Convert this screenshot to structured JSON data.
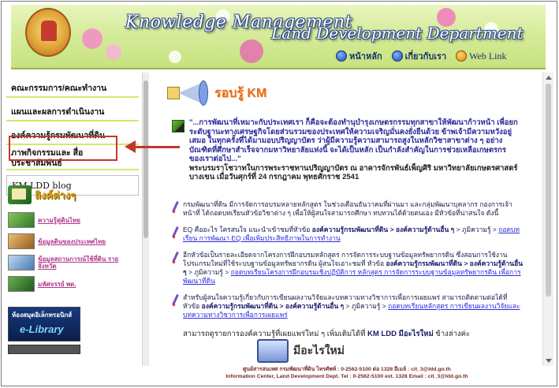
{
  "header": {
    "title_km": "Knowledge Management",
    "title_ldd": "Land Development Department",
    "nav": [
      {
        "label": "หน้าหลัก",
        "icon": "home-icon"
      },
      {
        "label": "เกี่ยวกับเรา",
        "icon": "info-icon"
      },
      {
        "label": "Web Link",
        "icon": "globe-icon"
      }
    ]
  },
  "sidebar": {
    "menu": [
      {
        "label": "คณะกรรมการ/คณะทำงาน"
      },
      {
        "label": "แผนและผลการดำเนินงาน"
      },
      {
        "label": "องค์ความรู้กรมพัฒนาที่ดิน"
      },
      {
        "label": "ภาพกิจกรรมและ สื่อประชาสัมพันธ์"
      }
    ],
    "km_blog": "KM LDD blog",
    "links_header": "ลิงค์ต่างๆ",
    "links": [
      {
        "label": "ความรู้คู่ดินไทย"
      },
      {
        "label": "ข้อมูลดินของประเทศไทย"
      },
      {
        "label": "ข้อมูลสถานการณ์ใช้ที่ดิน รายจังหวัด"
      },
      {
        "label": "มหัศจรรย์ พด."
      }
    ],
    "elibrary_top": "ห้องสมุดอิเล็กทรอนิกส์",
    "elibrary_main": "e-Library"
  },
  "main": {
    "news_title": "รอบรู้ KM",
    "quote": "\"...การพัฒนาที่เหมาะกับประเทศเรา ก็คือจะต้องทำนุบำรุงเกษตรกรรมทุกสาขาให้พัฒนาก้าวหน้า เพื่อยกระดับฐานะทางเศรษฐกิจโดยส่วนรวมของประเทศให้ความเจริญมั่นคงยั่งยืนด้วย ข้าพเจ้ามีความหวังอยู่เสมอ ในทุกครั้งที่ได้มามอบปริญญาบัตร ว่าผู้มีความรู้ความสามารถสูงในหลักวิชาสาขาต่าง ๆ อย่างบัณฑิตที่ศึกษาสำเร็จจากมหาวิทยาลัยแห่งนี้ จะได้เป็นหลัก เป็นกำลังสำคัญในการช่วยเหลือเกษตรกรของเราต่อไป...\"",
    "quote_ref": "พระบรมราโชวาทในการพระราชทานปริญญาบัตร ณ อาคารจักรพันธ์เพ็ญศิริ มหาวิทยาลัยเกษตรศาสตร์ บางเขน เมื่อวันศุกร์ที่ 24 กรกฎาคม พุทธศักราช 2541",
    "items": [
      {
        "text": "กรมพัฒนาที่ดิน มีการจัดการอบรมหลายหลักสูตร ในช่วงเดือนธันวาคมที่ผ่านมา และกลุ่มพัฒนาบุคลากร กองการเจ้าหน้าที่ ได้ถอดบทเรียนหัวข้อวิชาต่าง ๆ เพื่อให้ผู้สนใจสามารถศึกษา ทบทวนได้ด้วยตนเอง มีหัวข้อที่น่าสนใจ ดังนี้"
      },
      {
        "text": "EQ คืออะไร ใครสนใจ แนะนำเข้าชมที่หัวข้อ",
        "bold": "องค์ความรู้กรมพัฒนาที่ดิน > องค์ความรู้ด้านอื่น ๆ",
        "text2": " > ภูมิความรู้ > ",
        "link": "ถอดบทเรียน การพัฒนา EQ เพื่อเพิ่มประสิทธิภาพในการทำงาน"
      },
      {
        "text": "อีกหัวข้อเป็นรายละเอียดจากโครงการฝึกอบรมหลักสูตร การจัดการระบบฐานข้อมูลทรัพยากรดิน ซึ่งสอนการใช้งานโปรแกรมใหม่ที่ใช้ระบบฐานข้อมูลทรัพยากรดิน ผู้สนใจเอาะชมที่ หัวข้อ",
        "bold": "องค์ความรู้กรมพัฒนาที่ดิน > องค์ความรู้ด้านอื่น ๆ",
        "text2": " > ภูมิความรู้ > ",
        "link": "ถอดบทเรียนโครงการฝึกอบรมเชิงปฏิบัติการ หลักสูตร การจัดการระบบฐานข้อมูลทรัพยากรดิน เพื่อการพัฒนาที่ดิน"
      },
      {
        "text": "สำหรับผู้สนใจความรู้เกี่ยวกับการเขียนผลงานวิจัยและบทความทางวิชาการเพื่อการเผยแพร่ สามารถติดตามต่อได้ที่หัวข้อ",
        "bold": "องค์ความรู้กรมพัฒนาที่ดิน > องค์ความรู้ด้านอื่น ๆ",
        "text2": " > ภูมิความรู้ > ",
        "link": "ถอดบทเรียนหลักสูตร การเขียนผลงานวิจัยและบทความทางวิชาการเพื่อการเผยแพร่"
      }
    ],
    "more_prefix": "สามารถดูรายการองค์ความรู้ที่เผยแพร่ใหม่ ๆ เพิ่มเติมได้ที่",
    "more_bold": "KM LDD มีอะไรใหม่",
    "more_suffix": " ข้างล่างค่ะ",
    "new_title": "มีอะไรใหม่"
  },
  "footer": {
    "line1": "ศูนย์สารสนเทศ กรมพัฒนาที่ดิน โทรศัพท์ : 0-2562-5100 ต่อ 1328 อีเมล์ : cit_3@ldd.go.th",
    "line2": "Information Center, Land Development Dept. Tel : 0-2562-5100 ext. 1328 Email : cit_3@ldd.go.th"
  },
  "colors": {
    "accent_red": "#c0392b",
    "header_green": "#c6e27f",
    "link_blue": "#2a2ae0"
  }
}
